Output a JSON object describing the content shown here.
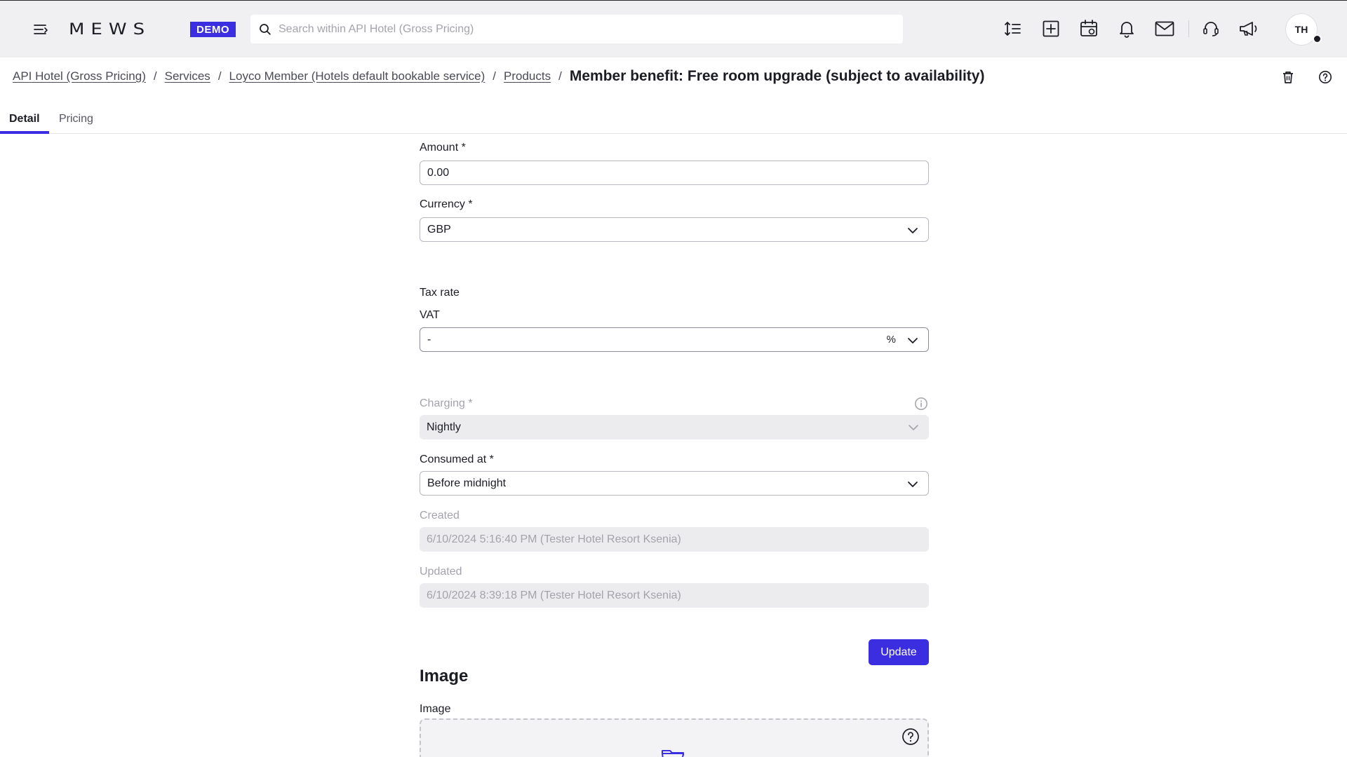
{
  "header": {
    "logo": "MEWS",
    "badge": "DEMO",
    "search_placeholder": "Search within API Hotel (Gross Pricing)",
    "user_initials": "TH",
    "icons": [
      "menu-icon",
      "sort-icon",
      "add-icon",
      "calendar-icon",
      "bell-icon",
      "mail-icon",
      "support-icon",
      "announcement-icon"
    ]
  },
  "breadcrumb": {
    "items": [
      "API Hotel (Gross Pricing)",
      "Services",
      "Loyco Member (Hotels default bookable service)",
      "Products"
    ],
    "separator": "/",
    "current": "Member benefit: Free room upgrade (subject to availability)"
  },
  "tabs": [
    {
      "label": "Detail",
      "active": true
    },
    {
      "label": "Pricing",
      "active": false
    }
  ],
  "form": {
    "amount_label": "Amount *",
    "amount_value": "0.00",
    "currency_label": "Currency *",
    "currency_value": "GBP",
    "tax_rate_label": "Tax rate",
    "vat_label": "VAT",
    "vat_value": "-",
    "vat_unit": "%",
    "charging_label": "Charging *",
    "charging_value": "Nightly",
    "consumed_label": "Consumed at *",
    "consumed_value": "Before midnight",
    "created_label": "Created",
    "created_value": "6/10/2024 5:16:40 PM (Tester Hotel Resort  Ksenia)",
    "updated_label": "Updated",
    "updated_value": "6/10/2024 8:39:18 PM (Tester Hotel Resort  Ksenia)",
    "update_button": "Update"
  },
  "image_section": {
    "heading": "Image",
    "label": "Image"
  },
  "colors": {
    "accent": "#3b2ee0",
    "topbar_bg": "#f0f0f2",
    "disabled_bg": "#ececef",
    "muted_text": "#a3a3ab"
  }
}
